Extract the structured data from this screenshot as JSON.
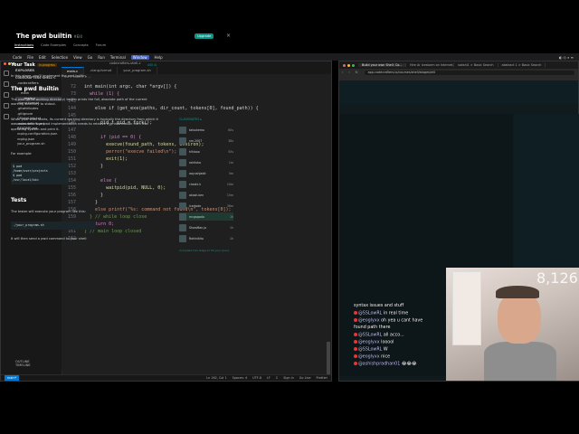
{
  "menubar": {
    "items": [
      "Code",
      "File",
      "Edit",
      "Selection",
      "View",
      "Go",
      "Run",
      "Terminal",
      "Window",
      "Help"
    ],
    "active_index": 8
  },
  "vscode": {
    "title": "codecrafters-shell-c",
    "sidebar": {
      "header": "EXPLORER",
      "root": "CODECRAFTERS-SHELL-C",
      "tree": [
        ".codecrafters",
        "src",
        "main",
        "main.c",
        ".clang-format",
        ".gitattributes",
        ".gitignore",
        "CMakeLists.txt",
        "codecrafters.yml",
        "README.md",
        "vcpkg-configuration.json",
        "vcpkg.json",
        "your_program.sh"
      ],
      "selected_index": 3,
      "outline": "OUTLINE",
      "timeline": "TIMELINE"
    },
    "tabs": [
      "main.c",
      ".clang-format",
      "your_program.sh"
    ],
    "breadcrumb": "src > main.c > ...",
    "lines": [
      {
        "n": "72",
        "t": "int main(int argc, char *argv[]) {",
        "k": "code"
      },
      {
        "n": "73",
        "t": "  while (1) {",
        "k": "kw"
      },
      {
        "n": "143",
        "t": "",
        "k": "code"
      },
      {
        "n": "144",
        "t": "    else if (get_exe(paths, dir_count, tokens[0], found_path)) {",
        "k": "code"
      },
      {
        "n": "145",
        "t": "",
        "k": "code"
      },
      {
        "n": "146",
        "t": "      pid_t pid = fork();",
        "k": "code"
      },
      {
        "n": "147",
        "t": "",
        "k": "code"
      },
      {
        "n": "148",
        "t": "      if (pid == 0) {",
        "k": "kw"
      },
      {
        "n": "149",
        "t": "        execve(found_path, tokens, environ);",
        "k": "fn"
      },
      {
        "n": "150",
        "t": "        perror(\"execve failed\\n\");",
        "k": "str"
      },
      {
        "n": "151",
        "t": "        exit(1);",
        "k": "fn"
      },
      {
        "n": "152",
        "t": "      }",
        "k": "code"
      },
      {
        "n": "153",
        "t": "",
        "k": "code"
      },
      {
        "n": "154",
        "t": "      else {",
        "k": "kw"
      },
      {
        "n": "155",
        "t": "        waitpid(pid, NULL, 0);",
        "k": "fn"
      },
      {
        "n": "156",
        "t": "      }",
        "k": "code"
      },
      {
        "n": "157",
        "t": "    }",
        "k": "code"
      },
      {
        "n": "158",
        "t": "    else printf(\"%s: command not found\\n\", tokens[0]);",
        "k": "str"
      },
      {
        "n": "159",
        "t": "  } // while loop close",
        "k": "cmt"
      },
      {
        "n": "160",
        "t": "  return 0;",
        "k": "kw"
      },
      {
        "n": "161",
        "t": "} // main loop closed",
        "k": "cmt"
      },
      {
        "n": "162",
        "t": "",
        "k": "code"
      }
    ],
    "status": {
      "remote": "main*",
      "position": "Ln 162, Col 1",
      "spaces": "Spaces: 4",
      "encoding": "UTF-8",
      "eol": "LF",
      "lang": "C",
      "signin": "Sign in",
      "golive": "Go Live",
      "prettier": "Prettier"
    }
  },
  "browser": {
    "tabs": [
      "Build your own Shell: Co...",
      "Hire Ar Icestorm on Internet...",
      "sakshi1 > Basic Search",
      "abstract 1 > Basic Search"
    ],
    "active_tab_index": 0,
    "url": "app.codecrafters.io/courses/shell/stages/ei0",
    "challenge_title": "The pwd builtin",
    "challenge_id": "#EI0",
    "upgrade": "Upgrade",
    "subtabs": [
      "Instructions",
      "Code Examples",
      "Concepts",
      "Forum"
    ],
    "task_heading": "Your Task",
    "task_badge": "In-progress",
    "ask_ai": "ASK AI",
    "task_intro": "In this stage, you'll implement the pwd builtin.",
    "section1_title": "The pwd Builtin",
    "section1_p1": "The pwd (print working directory) builtin prints the full, absolute path of the current working directory to stdout.",
    "section1_p2": "When your shell starts, its current working directory is typically the directory from which it was executed. Your pwd implementation needs to retrieve this information from the operating system and print it.",
    "example_label": "For example:",
    "example_code": [
      "$ pwd",
      "/home/user/projects",
      "$ pwd",
      "/usr/local/bin"
    ],
    "tests_title": "Tests",
    "tests_p": "The tester will execute your program like this:",
    "tests_code": "./your_program.sh",
    "tests_p2": "It will then send a pwd command to your shell:",
    "leaderboard_head": "CLASSMATES ▸",
    "leaderboard": [
      {
        "name": "tatsukemo",
        "time": "60s"
      },
      {
        "name": "vrn.2007",
        "time": "38s"
      },
      {
        "name": "hihiooo",
        "time": "55s"
      },
      {
        "name": "rohitsha",
        "time": "1m"
      },
      {
        "name": "aayushjadd",
        "time": "5m"
      },
      {
        "name": "cheshi.k",
        "time": "10m"
      },
      {
        "name": "akash.ken",
        "time": "15m"
      },
      {
        "name": "Icertode",
        "time": "36m"
      },
      {
        "name": "mcgagoda",
        "time": "1h"
      },
      {
        "name": "ShwaMan.jo",
        "time": "1h"
      },
      {
        "name": "Rohlnikito",
        "time": "1h"
      }
    ],
    "leaderboard_me_index": 8,
    "leaderboard_foot": "Complete this stage to fill your place"
  },
  "stream": {
    "viewer_count": "8,126",
    "chat": [
      {
        "user": "",
        "msg": "syntax issues and stuff"
      },
      {
        "user": "@SSLowRL",
        "msg": "in real time"
      },
      {
        "user": "@eoglyxx",
        "msg": "oh yea u cant have"
      },
      {
        "user": "",
        "msg": "found path there"
      },
      {
        "user": "@SSLowRL",
        "msg": "all acco..."
      },
      {
        "user": "@eoglyxx",
        "msg": "looool"
      },
      {
        "user": "@SSLowRL",
        "msg": "W"
      },
      {
        "user": "@eoglyxx",
        "msg": "nice"
      },
      {
        "user": "@ashishpradhan01",
        "msg": "😂😂😂"
      }
    ]
  },
  "colors": {
    "accent_teal": "#0d9488",
    "vscode_bg": "#1f1f1f",
    "browser_bg": "#0d171a"
  }
}
